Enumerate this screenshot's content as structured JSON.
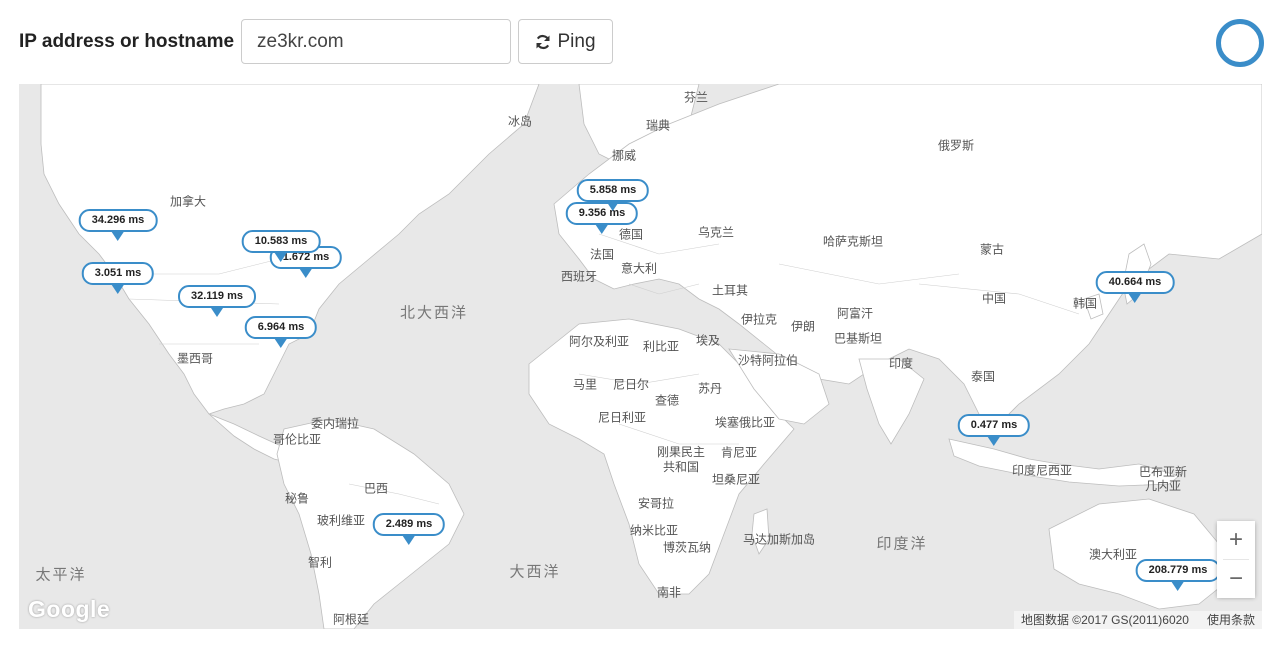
{
  "form": {
    "label": "IP address or hostname",
    "host_value": "ze3kr.com",
    "ping_label": "Ping"
  },
  "map": {
    "oceans": {
      "north_atlantic": "北大西洋",
      "south_atlantic": "大西洋",
      "pacific": "太平洋",
      "indian": "印度洋"
    },
    "countries": {
      "finland": "芬兰",
      "iceland": "冰岛",
      "sweden": "瑞典",
      "norway": "挪威",
      "russia": "俄罗斯",
      "canada": "加拿大",
      "germany": "德国",
      "ukraine": "乌克兰",
      "france": "法国",
      "italy": "意大利",
      "spain": "西班牙",
      "kazakhstan": "哈萨克斯坦",
      "mongolia": "蒙古",
      "turkey": "土耳其",
      "china": "中国",
      "korea": "韩国",
      "iraq": "伊拉克",
      "iran": "伊朗",
      "afghanistan": "阿富汗",
      "pakistan": "巴基斯坦",
      "algeria": "阿尔及利亚",
      "libya": "利比亚",
      "egypt": "埃及",
      "saudi": "沙特阿拉伯",
      "india": "印度",
      "thailand": "泰国",
      "mali": "马里",
      "niger": "尼日尔",
      "sudan": "苏丹",
      "chad": "查德",
      "nigeria": "尼日利亚",
      "ethiopia": "埃塞俄比亚",
      "mexico": "墨西哥",
      "venezuela": "委内瑞拉",
      "colombia": "哥伦比亚",
      "drc": "刚果民主\n共和国",
      "kenya": "肯尼亚",
      "tanzania": "坦桑尼亚",
      "indonesia": "印度尼西亚",
      "png": "巴布亚新\n几内亚",
      "brazil": "巴西",
      "peru": "秘鲁",
      "bolivia": "玻利维亚",
      "angola": "安哥拉",
      "namibia": "纳米比亚",
      "botswana": "博茨瓦纳",
      "madagascar": "马达加斯加岛",
      "australia": "澳大利亚",
      "chile": "智利",
      "south_africa": "南非",
      "argentina": "阿根廷"
    },
    "results": [
      {
        "ms": "34.296 ms"
      },
      {
        "ms": "3.051 ms"
      },
      {
        "ms": "10.583 ms"
      },
      {
        "ms": "1.672 ms"
      },
      {
        "ms": "32.119 ms"
      },
      {
        "ms": "6.964 ms"
      },
      {
        "ms": "2.489 ms"
      },
      {
        "ms": "5.858 ms"
      },
      {
        "ms": "9.356 ms"
      },
      {
        "ms": "40.664 ms"
      },
      {
        "ms": "0.477 ms"
      },
      {
        "ms": "208.779 ms"
      }
    ],
    "zoom_in": "+",
    "zoom_out": "−",
    "logo": "Google",
    "attribution": "地图数据 ©2017 GS(2011)6020",
    "terms": "使用条款"
  },
  "colors": {
    "accent": "#3a8dc9",
    "land": "#ffffff",
    "water": "#e8e8e8"
  }
}
